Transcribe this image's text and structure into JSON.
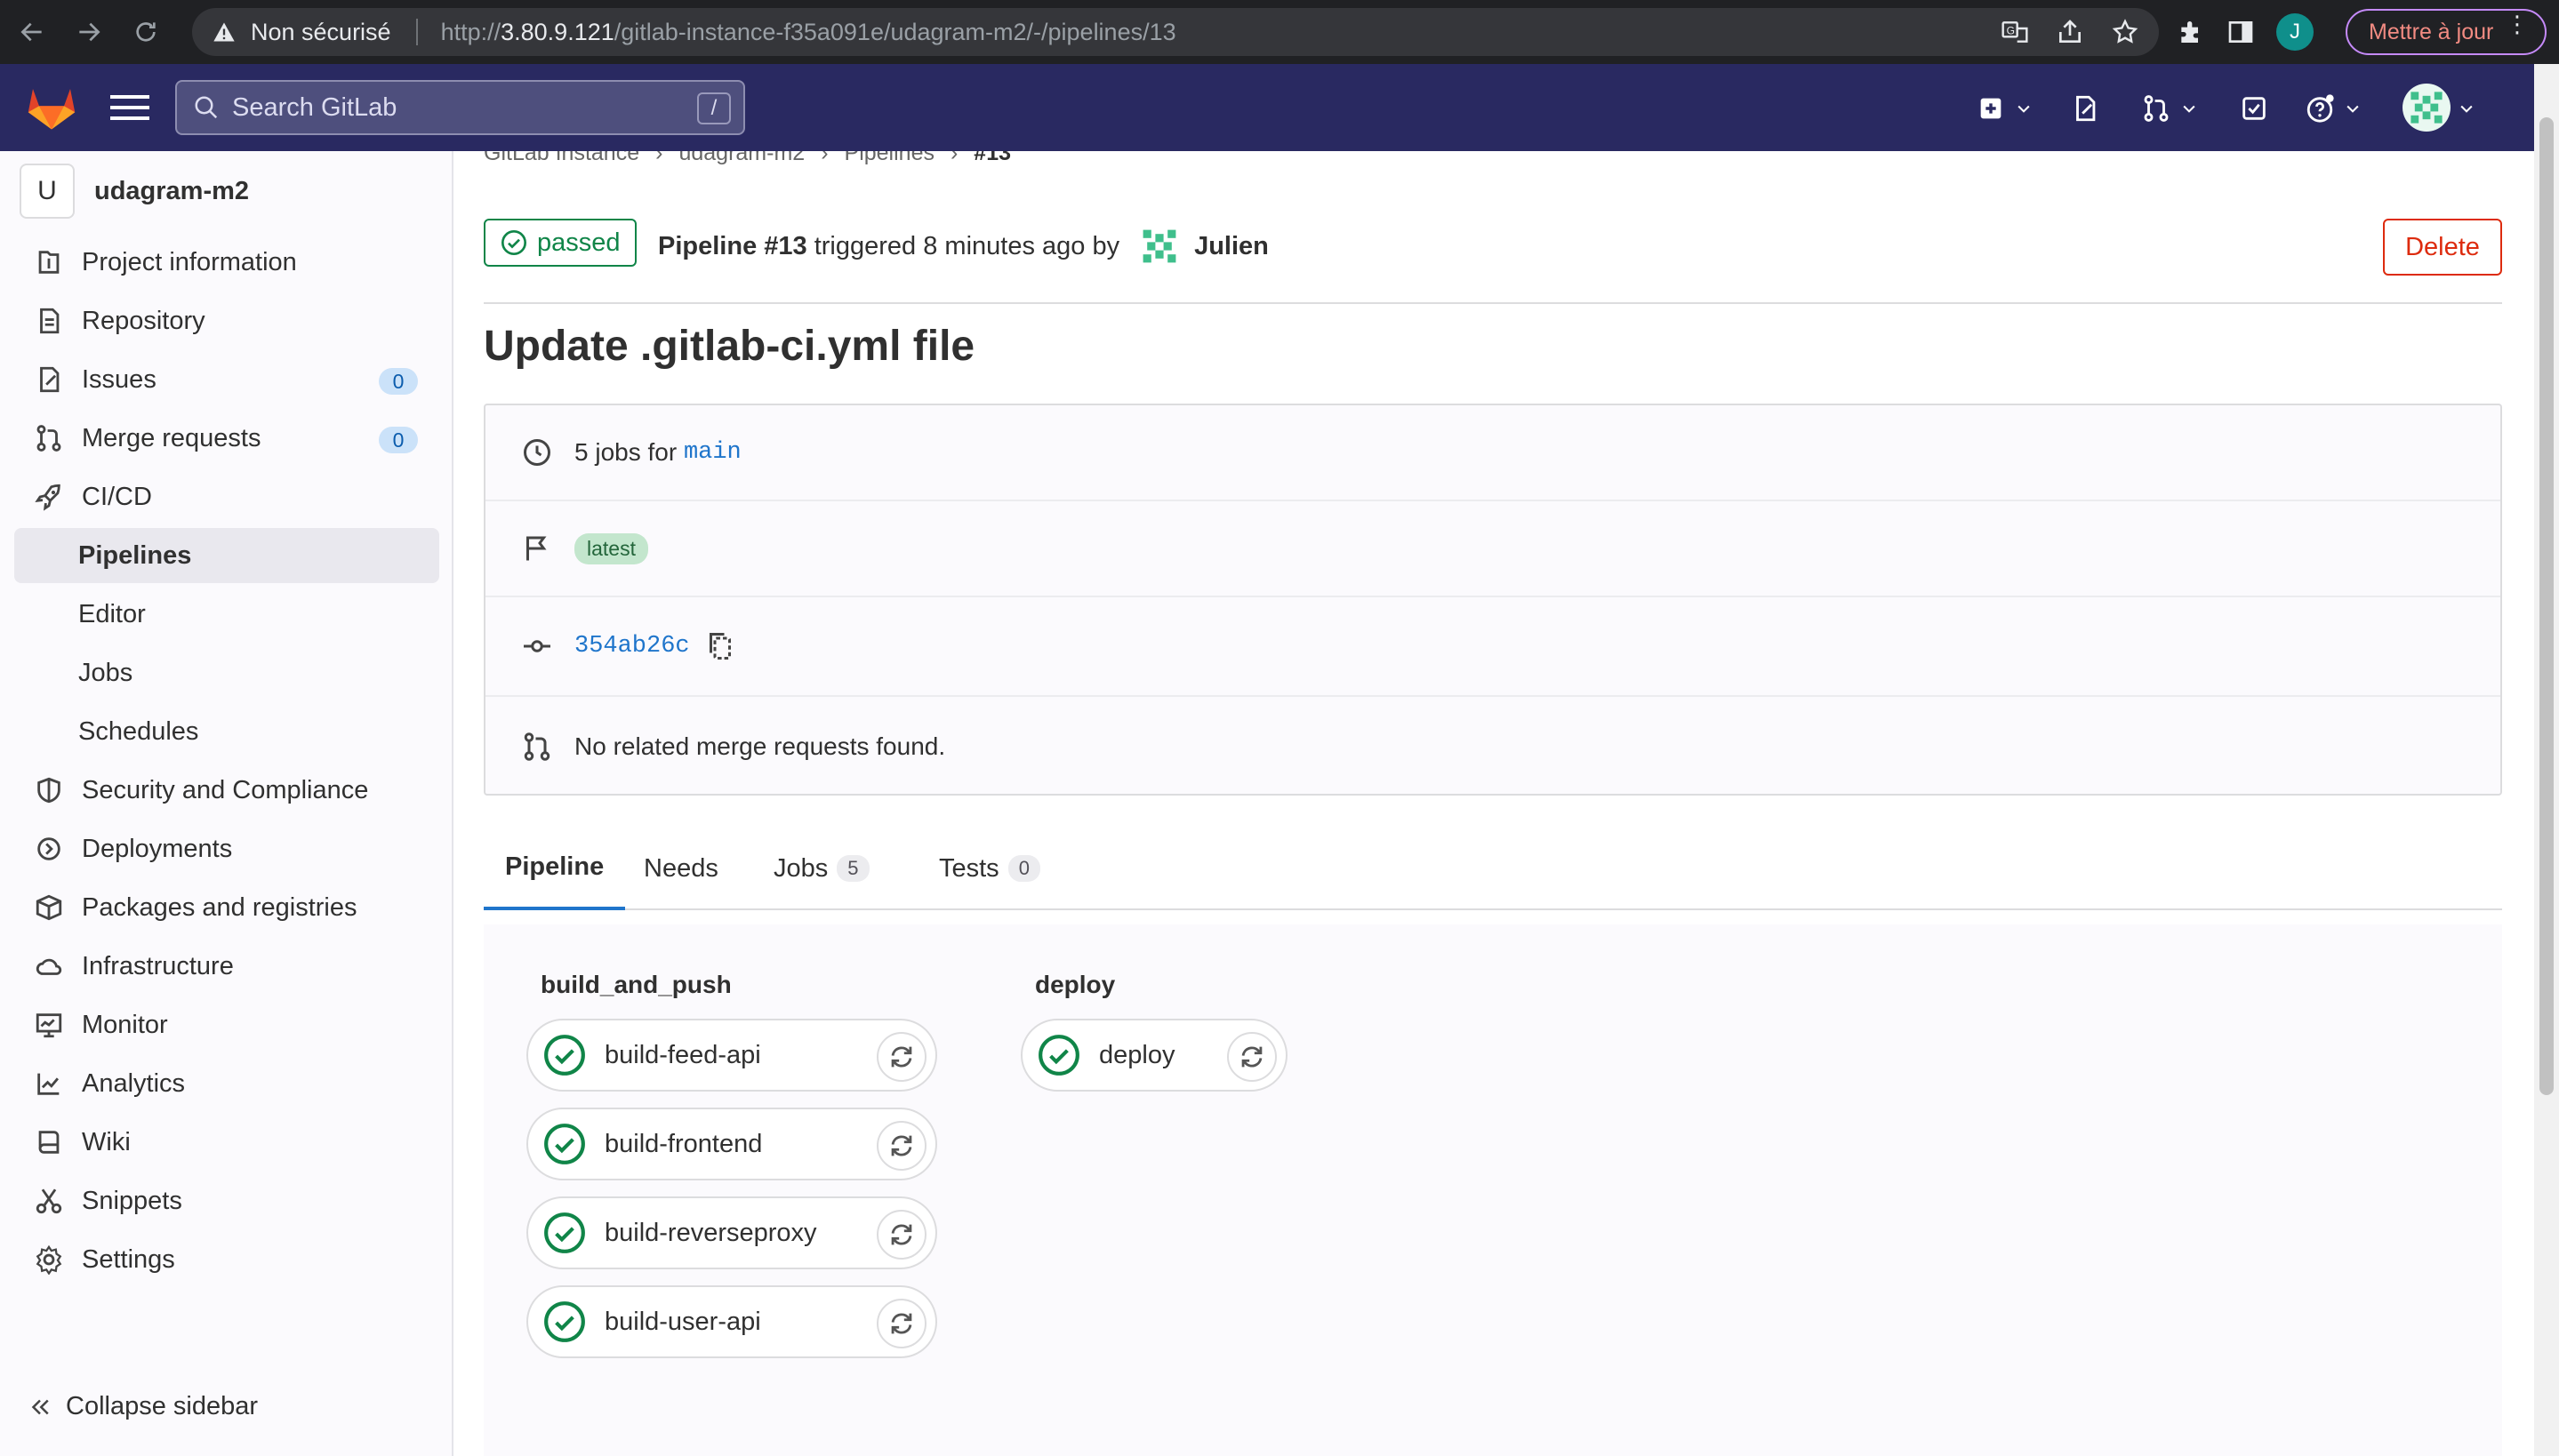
{
  "browser": {
    "security_label": "Non sécurisé",
    "url_prefix": "http://",
    "url_host": "3.80.9.121",
    "url_path": "/gitlab-instance-f35a091e/udagram-m2/-/pipelines/13",
    "profile_initial": "J",
    "update_label": "Mettre à jour"
  },
  "topbar": {
    "search_placeholder": "Search GitLab",
    "search_shortcut": "/"
  },
  "sidebar": {
    "project_initial": "U",
    "project_name": "udagram-m2",
    "items": [
      {
        "label": "Project information",
        "icon": "project-information-icon"
      },
      {
        "label": "Repository",
        "icon": "repository-icon"
      },
      {
        "label": "Issues",
        "icon": "issues-icon",
        "count": "0"
      },
      {
        "label": "Merge requests",
        "icon": "merge-request-icon",
        "count": "0"
      },
      {
        "label": "CI/CD",
        "icon": "rocket-icon"
      },
      {
        "label": "Pipelines",
        "active": true
      },
      {
        "label": "Editor"
      },
      {
        "label": "Jobs"
      },
      {
        "label": "Schedules"
      },
      {
        "label": "Security and Compliance",
        "icon": "shield-icon"
      },
      {
        "label": "Deployments",
        "icon": "deployments-icon"
      },
      {
        "label": "Packages and registries",
        "icon": "package-icon"
      },
      {
        "label": "Infrastructure",
        "icon": "cloud-icon"
      },
      {
        "label": "Monitor",
        "icon": "monitor-icon"
      },
      {
        "label": "Analytics",
        "icon": "chart-icon"
      },
      {
        "label": "Wiki",
        "icon": "book-icon"
      },
      {
        "label": "Snippets",
        "icon": "scissors-icon"
      },
      {
        "label": "Settings",
        "icon": "gear-icon"
      }
    ],
    "collapse_label": "Collapse sidebar"
  },
  "breadcrumb": [
    "GitLab Instance",
    "udagram-m2",
    "Pipelines",
    "#13"
  ],
  "pipeline": {
    "status": "passed",
    "title": "Pipeline #13",
    "triggered_text": "triggered 8 minutes ago by",
    "user": "Julien",
    "delete_label": "Delete",
    "commit_title": "Update .gitlab-ci.yml file",
    "jobs_text": "5 jobs for",
    "branch": "main",
    "badge": "latest",
    "sha": "354ab26c",
    "merge_requests_text": "No related merge requests found."
  },
  "tabs": [
    {
      "label": "Pipeline",
      "active": true
    },
    {
      "label": "Needs"
    },
    {
      "label": "Jobs",
      "count": "5"
    },
    {
      "label": "Tests",
      "count": "0"
    }
  ],
  "stages": [
    {
      "name": "build_and_push",
      "jobs": [
        "build-feed-api",
        "build-frontend",
        "build-reverseproxy",
        "build-user-api"
      ]
    },
    {
      "name": "deploy",
      "jobs": [
        "deploy"
      ]
    }
  ],
  "colors": {
    "topbar": "#292961",
    "success": "#108548",
    "link": "#1f75cb",
    "danger": "#dd2b0e"
  }
}
